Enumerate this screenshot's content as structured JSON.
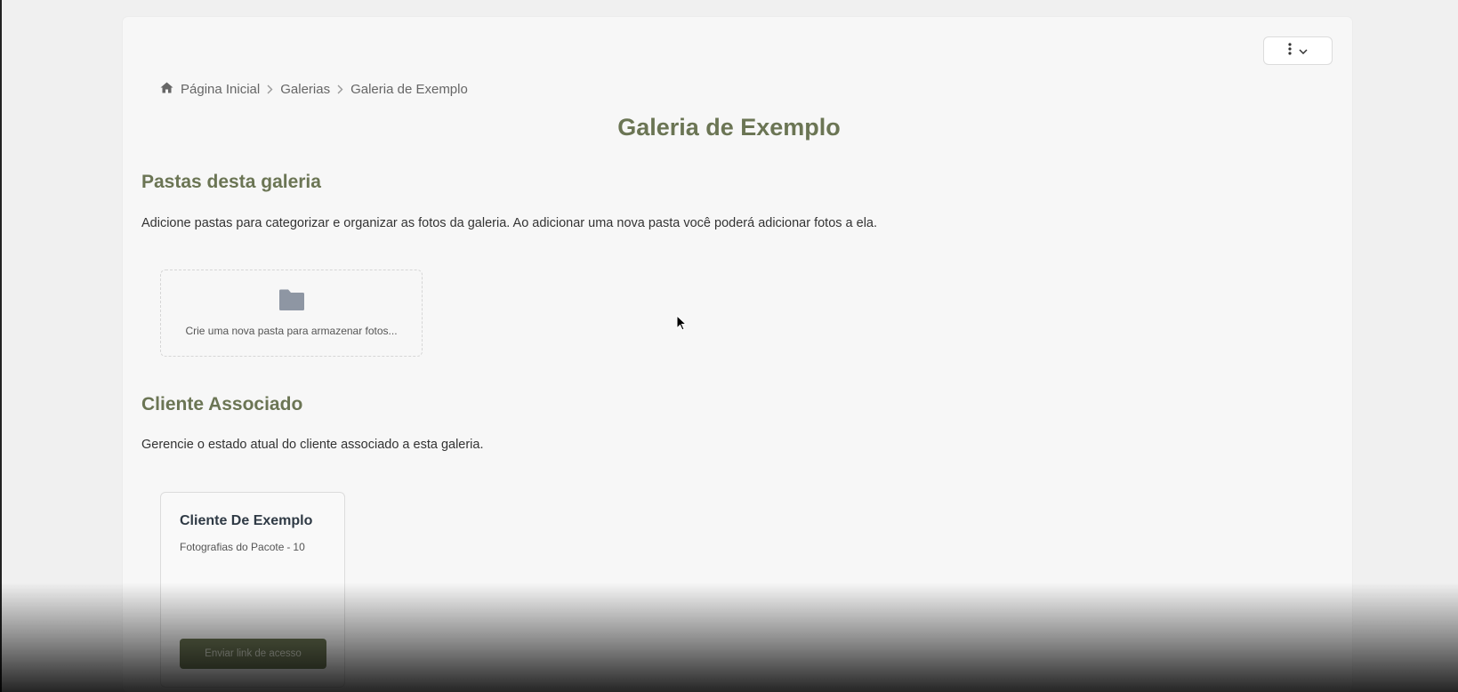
{
  "header": {
    "menu_button_icon": "vertical-dots-icon",
    "menu_chevron_icon": "chevron-down-icon"
  },
  "breadcrumb": {
    "home_icon": "home-icon",
    "items": [
      "Página Inicial",
      "Galerias",
      "Galeria de Exemplo"
    ]
  },
  "page": {
    "title": "Galeria de Exemplo"
  },
  "folders_section": {
    "title": "Pastas desta galeria",
    "description": "Adicione pastas para categorizar e organizar as fotos da galeria. Ao adicionar uma nova pasta você poderá adicionar fotos a ela.",
    "new_folder_icon": "folder-icon",
    "new_folder_text": "Crie uma nova pasta para armazenar fotos..."
  },
  "client_section": {
    "title": "Cliente Associado",
    "description": "Gerencie o estado atual do cliente associado a esta galeria.",
    "client": {
      "name": "Cliente De Exemplo",
      "package_label": "Fotografias do Pacote",
      "package_separator": "-",
      "package_count": "10",
      "send_button_label": "Enviar link de acesso"
    }
  },
  "colors": {
    "accent": "#6b7554",
    "text": "#333333",
    "background": "#f7f7f7"
  }
}
